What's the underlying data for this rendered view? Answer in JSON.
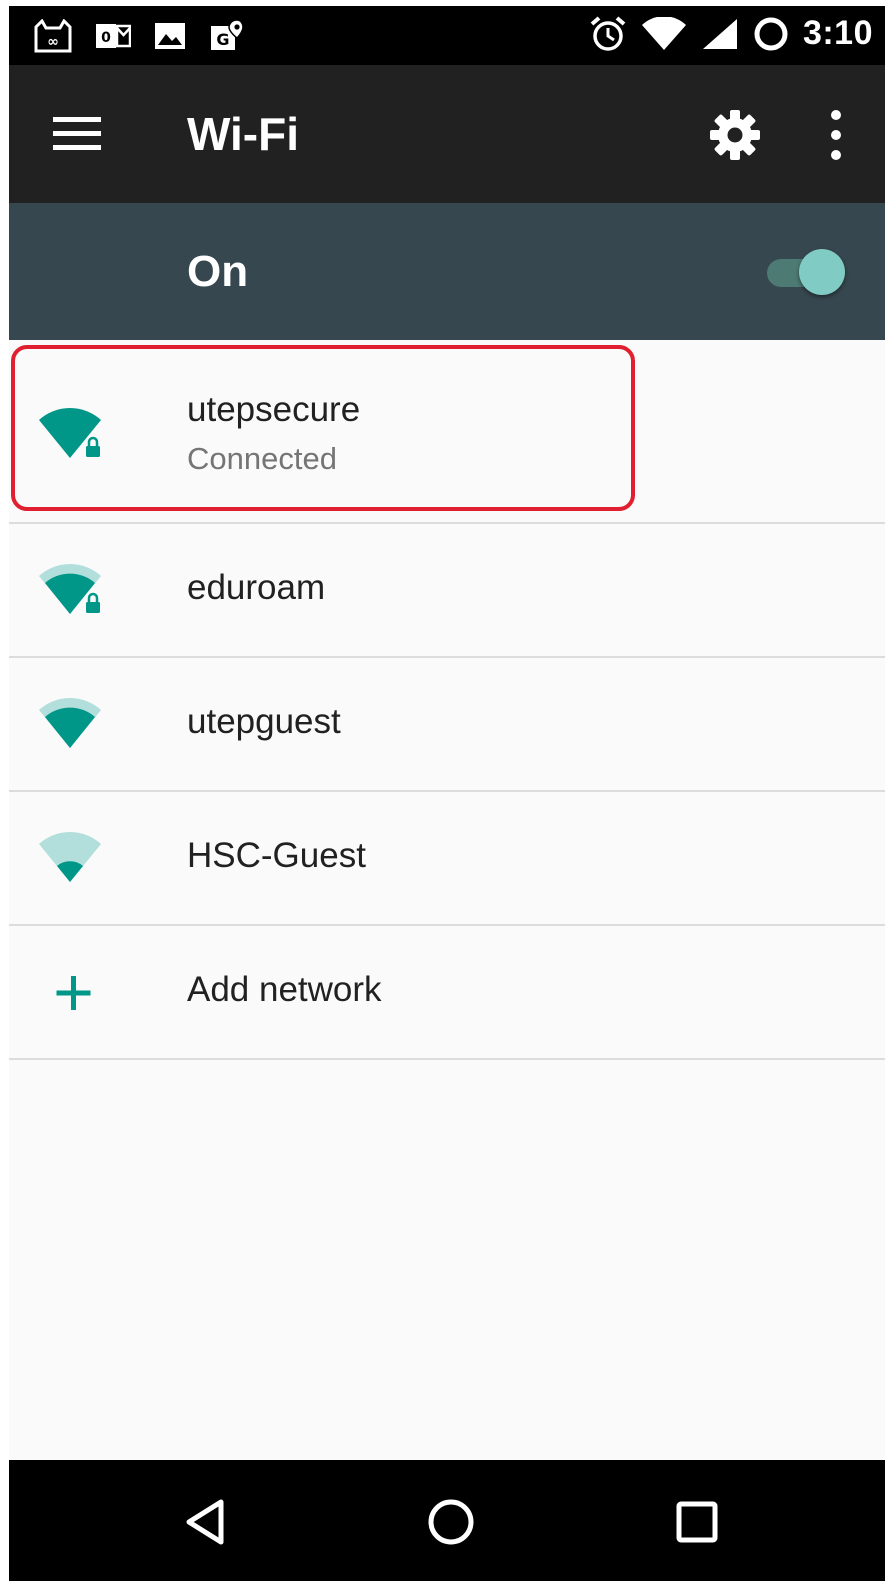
{
  "status_bar": {
    "clock": "3:10",
    "notification_icons": [
      "cat-app-icon",
      "outlook-icon",
      "image-icon",
      "maps-icon"
    ],
    "system_icons": [
      "alarm-icon",
      "wifi-signal-icon",
      "cell-signal-icon",
      "battery-circle-icon"
    ]
  },
  "toolbar": {
    "title": "Wi-Fi",
    "menu_icon": "hamburger-menu-icon",
    "settings_icon": "gear-icon",
    "overflow_icon": "more-vertical-icon"
  },
  "wifi_switch": {
    "label": "On",
    "state": "on"
  },
  "networks": [
    {
      "ssid": "utepsecure",
      "status": "Connected",
      "secured": true,
      "signal_level": 4
    },
    {
      "ssid": "eduroam",
      "status": "",
      "secured": true,
      "signal_level": 3
    },
    {
      "ssid": "utepguest",
      "status": "",
      "secured": false,
      "signal_level": 3
    },
    {
      "ssid": "HSC-Guest",
      "status": "",
      "secured": false,
      "signal_level": 1
    }
  ],
  "add_network": {
    "label": "Add network",
    "icon": "plus-icon"
  },
  "nav_bar": {
    "icons": [
      "back-icon",
      "home-icon",
      "recents-icon"
    ]
  },
  "colors": {
    "accent": "#009688",
    "accent_light": "#b2dfdb",
    "toolbar": "#212121",
    "switch_bar": "#37474f",
    "highlight": "#e02030"
  }
}
